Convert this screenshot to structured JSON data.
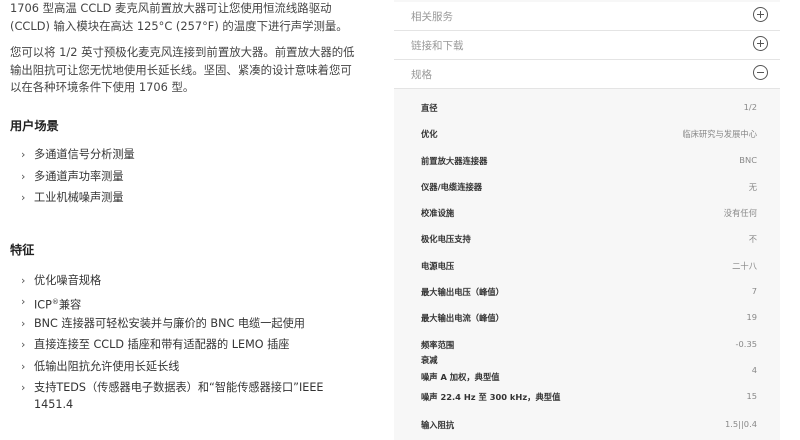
{
  "description": {
    "para1_line1": "1706 型高温 CCLD 麦克风前置放大器可让您使用恒流线路驱动",
    "para1_line2": "(CCLD) 输入模块在高达 125°C (257°F) 的温度下进行声学测量。",
    "para2_line1": "您可以将 1/2 英寸预极化麦克风连接到前置放大器。前置放大器的低",
    "para2_line2": "输出阻抗可让您无忧地使用长延长线。坚固、紧凑的设计意味着您可",
    "para2_line3": "以在各种环境条件下使用 1706 型。"
  },
  "use_cases": {
    "heading": "用户场景",
    "items": [
      "多通道信号分析测量",
      "多通道声功率测量",
      "工业机械噪声测量"
    ]
  },
  "features": {
    "heading": "特征",
    "items": [
      "优化噪音规格",
      "ICP",
      "BNC 连接器可轻松安装并与廉价的 BNC 电缆一起使用",
      "直接连接至 CCLD 插座和带有适配器的 LEMO 插座",
      "低输出阻抗允许使用长延长线",
      "支持TEDS（传感器电子数据表）和“智能传感器接口”IEEE"
    ],
    "icp_sup": "®",
    "icp_suffix": "兼容",
    "ieee_line2": "1451.4"
  },
  "accordion": {
    "related_services": "相关服务",
    "links_downloads": "链接和下载",
    "specs": "规格"
  },
  "specs": [
    {
      "label": "直径",
      "value": "1/2"
    },
    {
      "label": "优化",
      "value": "临床研究与发展中心"
    },
    {
      "label": "前置放大器连接器",
      "value": "BNC"
    },
    {
      "label": "仪器/电缆连接器",
      "value": "无"
    },
    {
      "label": "校准设施",
      "value": "没有任何"
    },
    {
      "label": "极化电压支持",
      "value": "不"
    },
    {
      "label": "电源电压",
      "value": "二十八"
    },
    {
      "label": "最大输出电压（峰值）",
      "value": "7"
    },
    {
      "label": "最大输出电流（峰值）",
      "value": "19"
    },
    {
      "label": "频率范围",
      "value": "-0.35"
    },
    {
      "label": "衰减",
      "value": ""
    },
    {
      "label": "噪声 A 加权，典型值",
      "value": "4"
    },
    {
      "label": "噪声 22.4 Hz 至 300 kHz，典型值",
      "value": "15"
    },
    {
      "label": "输入阻抗",
      "value": "1.5||0.4"
    }
  ]
}
